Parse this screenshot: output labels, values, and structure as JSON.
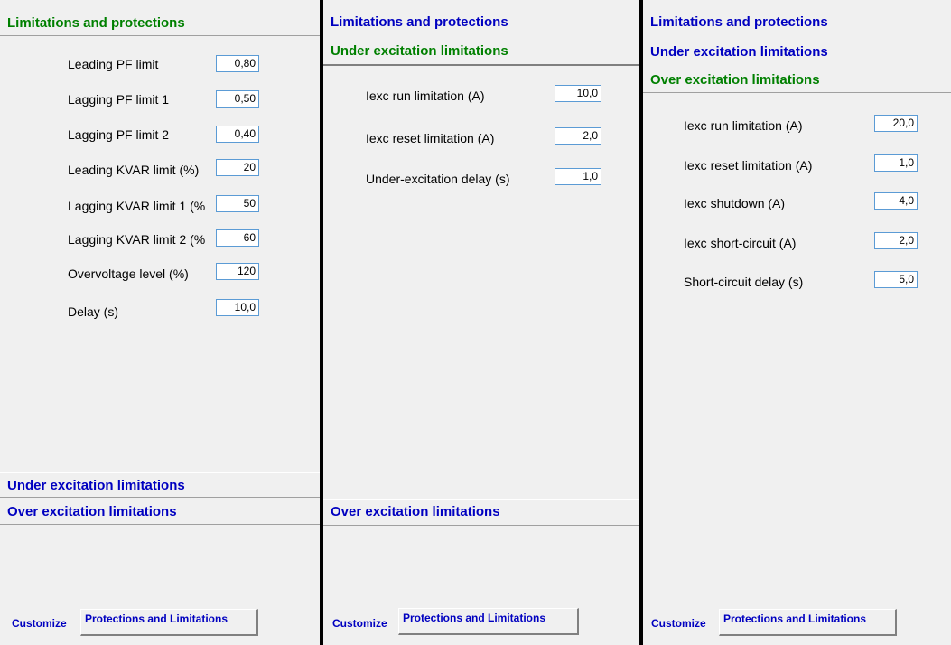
{
  "panel1": {
    "hdr_limitations": "Limitations and protections",
    "fields": [
      {
        "label": "Leading PF limit",
        "value": "0,80"
      },
      {
        "label": "Lagging PF limit 1",
        "value": "0,50"
      },
      {
        "label": "Lagging PF limit 2",
        "value": "0,40"
      },
      {
        "label": "Leading KVAR limit (%)",
        "value": "20"
      },
      {
        "label": "Lagging KVAR limit 1 (%",
        "value": "50"
      },
      {
        "label": "Lagging KVAR limit 2 (%",
        "value": "60"
      },
      {
        "label": "Overvoltage level (%)",
        "value": "120"
      },
      {
        "label": "Delay (s)",
        "value": "10,0"
      }
    ],
    "hdr_under": "Under excitation limitations",
    "hdr_over": "Over excitation limitations",
    "customize": "Customize",
    "tab": "Protections and Limitations"
  },
  "panel2": {
    "hdr_limitations": "Limitations and protections",
    "hdr_under": "Under excitation limitations",
    "fields": [
      {
        "label": "Iexc run limitation (A)",
        "value": "10,0"
      },
      {
        "label": "Iexc reset limitation (A)",
        "value": "2,0"
      },
      {
        "label": "Under-excitation delay (s)",
        "value": "1,0"
      }
    ],
    "hdr_over": "Over excitation limitations",
    "customize": "Customize",
    "tab": "Protections and Limitations"
  },
  "panel3": {
    "hdr_limitations": "Limitations and protections",
    "hdr_under": "Under excitation limitations",
    "hdr_over": "Over excitation limitations",
    "fields": [
      {
        "label": "Iexc run limitation (A)",
        "value": "20,0"
      },
      {
        "label": "Iexc reset limitation (A)",
        "value": "1,0"
      },
      {
        "label": "Iexc shutdown (A)",
        "value": "4,0"
      },
      {
        "label": "Iexc short-circuit (A)",
        "value": "2,0"
      },
      {
        "label": "Short-circuit delay (s)",
        "value": "5,0"
      }
    ],
    "customize": "Customize",
    "tab": "Protections and Limitations"
  }
}
